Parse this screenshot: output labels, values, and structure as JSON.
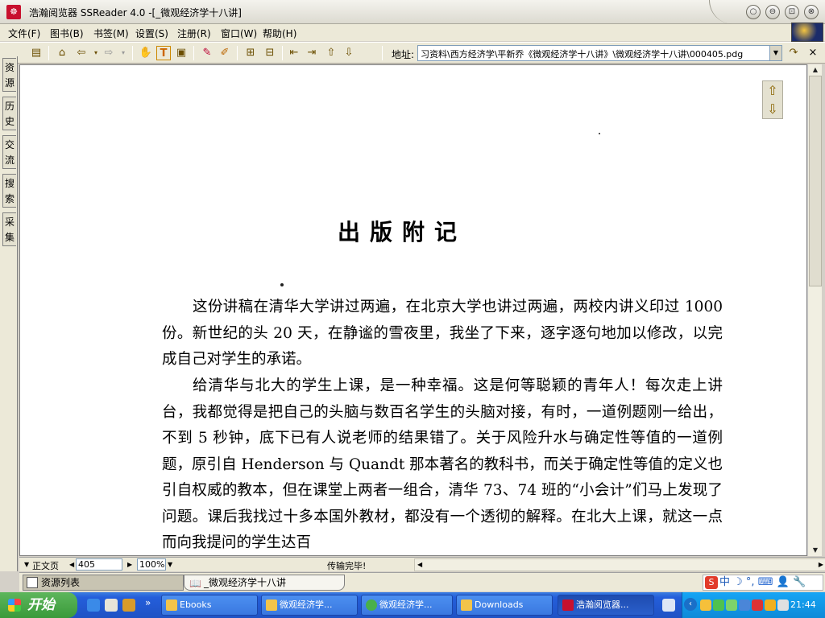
{
  "window": {
    "title": "浩瀚阅览器 SSReader 4.0 -[_微观经济学十八讲]",
    "buttons": [
      "minimize-icon",
      "restore-icon",
      "maximize-icon",
      "close-icon"
    ]
  },
  "menu": [
    "文件(F)",
    "图书(B)",
    "书签(M)",
    "设置(S)",
    "注册(R)",
    "窗口(W)",
    "帮助(H)"
  ],
  "toolbar": {
    "address_label": "地址:",
    "address_value": "习资料\\西方经济学\\平新乔《微观经济学十八讲》\\微观经济学十八讲\\000405.pdg",
    "close_glyph": "×"
  },
  "sidebar_tabs": [
    "资源",
    "历史",
    "交流",
    "搜索",
    "采集"
  ],
  "document": {
    "title": "出版附记",
    "paragraphs": [
      "这份讲稿在清华大学讲过两遍，在北京大学也讲过两遍，两校内讲义印过 1000 份。新世纪的头 20 天，在静谧的雪夜里，我坐了下来，逐字逐句地加以修改，以完成自己对学生的承诺。",
      "给清华与北大的学生上课，是一种幸福。这是何等聪颖的青年人！每次走上讲台，我都觉得是把自己的头脑与数百名学生的头脑对接，有时，一道例题刚一给出，不到 5 秒钟，底下已有人说老师的结果错了。关于风险升水与确定性等值的一道例题，原引自 Henderson 与 Quandt 那本著名的教科书，而关于确定性等值的定义也引自权威的教本，但在课堂上两者一组合，清华 73、74 班的“小会计”们马上发现了问题。课后我找过十多本国外教材，都没有一个透彻的解释。在北大上课，就这一点而向我提问的学生达百"
    ]
  },
  "status": {
    "page_mode": "正文页",
    "page_number": "405",
    "zoom": "100%",
    "message": "传输完毕!"
  },
  "tabs": {
    "resource_list": "资源列表",
    "book_tab": "_微观经济学十八讲"
  },
  "ime": {
    "s": "S",
    "text": "中 ☽ °,"
  },
  "taskbar": {
    "start": "开始",
    "chevron": "»",
    "buttons": [
      {
        "label": "Ebooks",
        "icon": "folder-icon"
      },
      {
        "label": "微观经济学...",
        "icon": "folder-icon"
      },
      {
        "label": "微观经济学...",
        "icon": "browser-icon"
      },
      {
        "label": "Downloads",
        "icon": "folder-icon"
      },
      {
        "label": "浩瀚阅览器...",
        "icon": "ssreader-icon"
      }
    ],
    "clock": "21:44"
  },
  "colors": {
    "taskbar_blue": "#245edb",
    "start_green": "#3a9a3a",
    "tray_blue": "#0e8ad8",
    "brand_red": "#c8102e"
  }
}
